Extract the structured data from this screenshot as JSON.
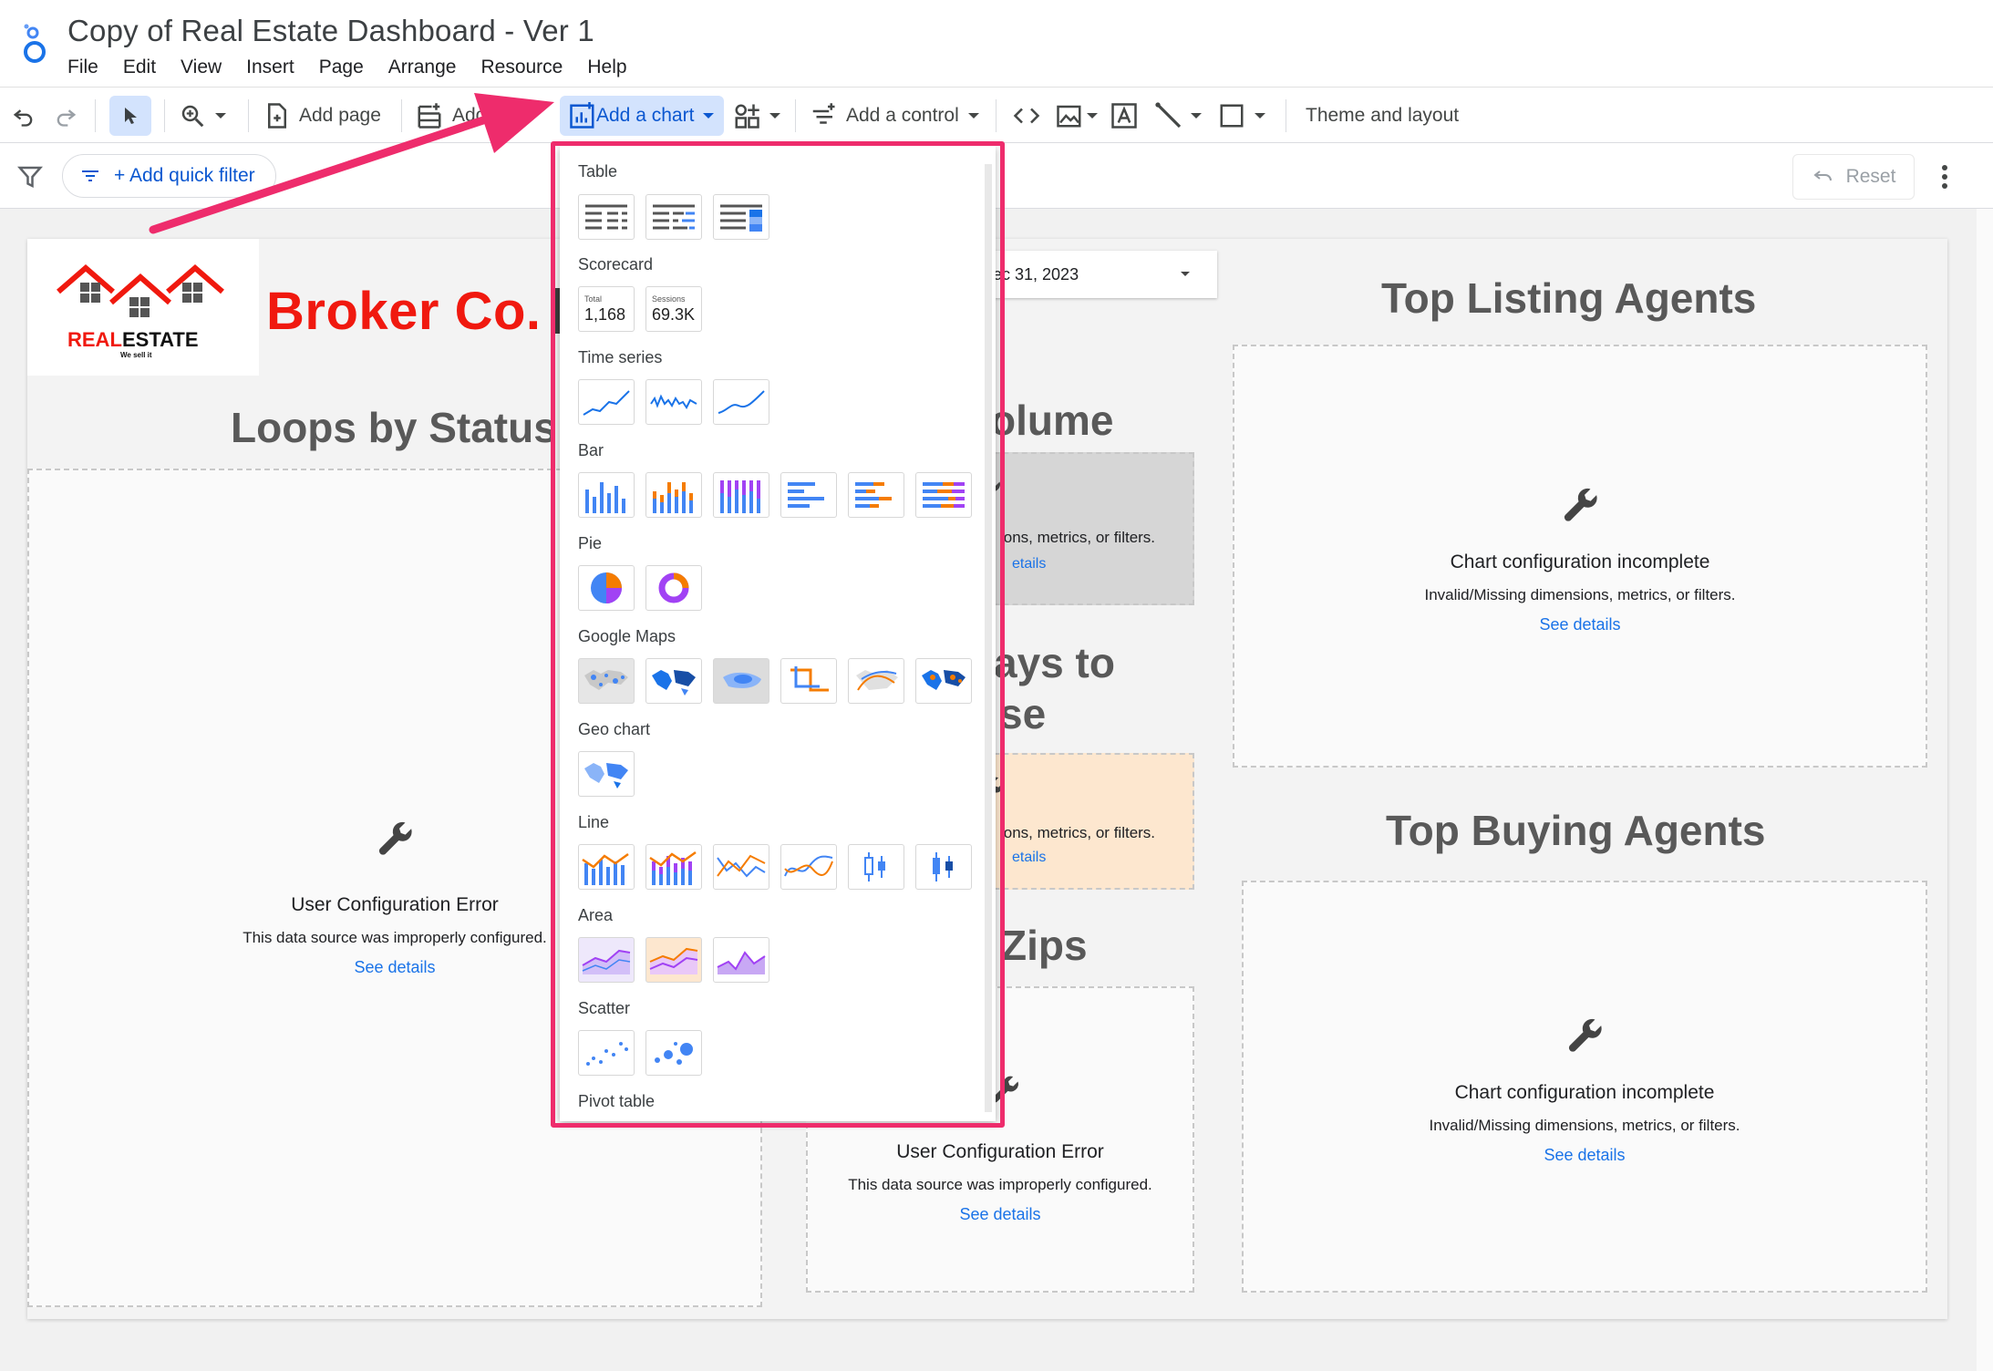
{
  "document": {
    "title": "Copy of Real Estate Dashboard - Ver 1"
  },
  "menubar": [
    "File",
    "Edit",
    "View",
    "Insert",
    "Page",
    "Arrange",
    "Resource",
    "Help"
  ],
  "toolbar": {
    "add_page": "Add page",
    "add_data": "Add d",
    "add_chart": "Add a chart",
    "add_control": "Add a control",
    "theme_layout": "Theme and layout"
  },
  "filterbar": {
    "add_quick_filter": "+ Add quick filter",
    "reset": "Reset"
  },
  "brand": {
    "name": "Broker Co.",
    "logo_text": "REALESTATE",
    "logo_tagline": "We sell it",
    "logo_accent": "#f0190f"
  },
  "date_control": {
    "value": "ec 31, 2023"
  },
  "sections": {
    "loops_by_status": "Loops by Status",
    "volume": "olume",
    "days_to_close_1": "ays to",
    "days_to_close_2": "se",
    "zips": "Zips",
    "top_listing_agents": "Top Listing Agents",
    "top_buying_agents": "Top Buying Agents"
  },
  "messages": {
    "user_config_error": "User Configuration Error",
    "user_config_sub": "This data source was improperly configured.",
    "chart_incomplete": "Chart configuration incomplete",
    "chart_incomplete_sub": "Invalid/Missing dimensions, metrics, or filters.",
    "chart_incomplete_sub_cut": "ions, metrics, or filters.",
    "see_details": "See details",
    "see_details_cut": "etails"
  },
  "chart_menu": {
    "categories": {
      "table": "Table",
      "scorecard": "Scorecard",
      "time_series": "Time series",
      "bar": "Bar",
      "pie": "Pie",
      "google_maps": "Google Maps",
      "geo_chart": "Geo chart",
      "line": "Line",
      "area": "Area",
      "scatter": "Scatter",
      "pivot_table": "Pivot table"
    },
    "scorecard_thumbs": [
      {
        "label": "Total",
        "value": "1,168"
      },
      {
        "label": "Sessions",
        "value": "69.3K"
      }
    ]
  },
  "colors": {
    "accent_blue": "#1a73e8",
    "highlight_pink": "#ee2c6c",
    "chart_orange": "#f57c00",
    "chart_purple": "#a142f4"
  }
}
